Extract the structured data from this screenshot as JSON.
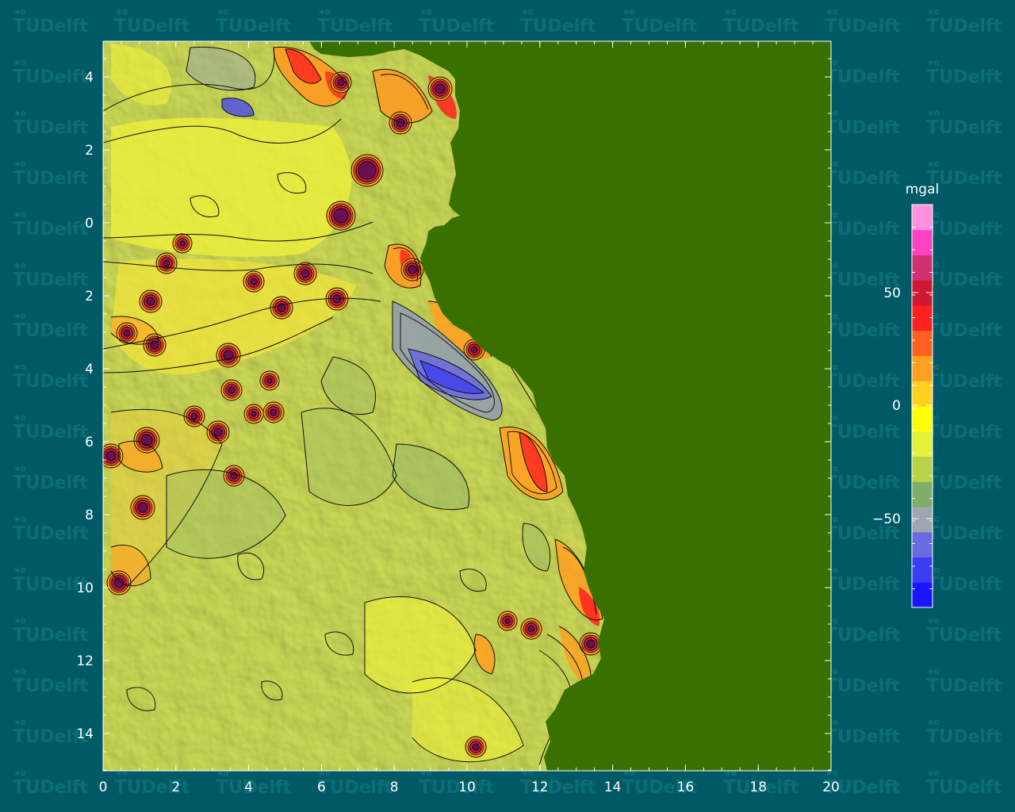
{
  "watermark": {
    "text_a": "TU",
    "text_b": "Delft"
  },
  "map": {
    "x_ticks": [
      "0",
      "2",
      "4",
      "6",
      "8",
      "10",
      "12",
      "14",
      "16",
      "18",
      "20"
    ],
    "y_ticks": [
      "4",
      "2",
      "0",
      "2",
      "4",
      "6",
      "8",
      "10",
      "12",
      "14"
    ],
    "land_color": "#3a7000",
    "sea_color": "#d2e05a"
  },
  "colorbar": {
    "unit": "mgal",
    "tick_labels": [
      "50",
      "0",
      "−50"
    ],
    "colors": [
      "#1a14ff",
      "#3c3cf0",
      "#6a6ae0",
      "#9ea6b0",
      "#7fae6a",
      "#b9d24a",
      "#e6f23a",
      "#ffff00",
      "#ffd020",
      "#ffa020",
      "#ff6020",
      "#ff2020",
      "#d01830",
      "#d03070",
      "#ff40c0",
      "#ff90e0"
    ]
  }
}
